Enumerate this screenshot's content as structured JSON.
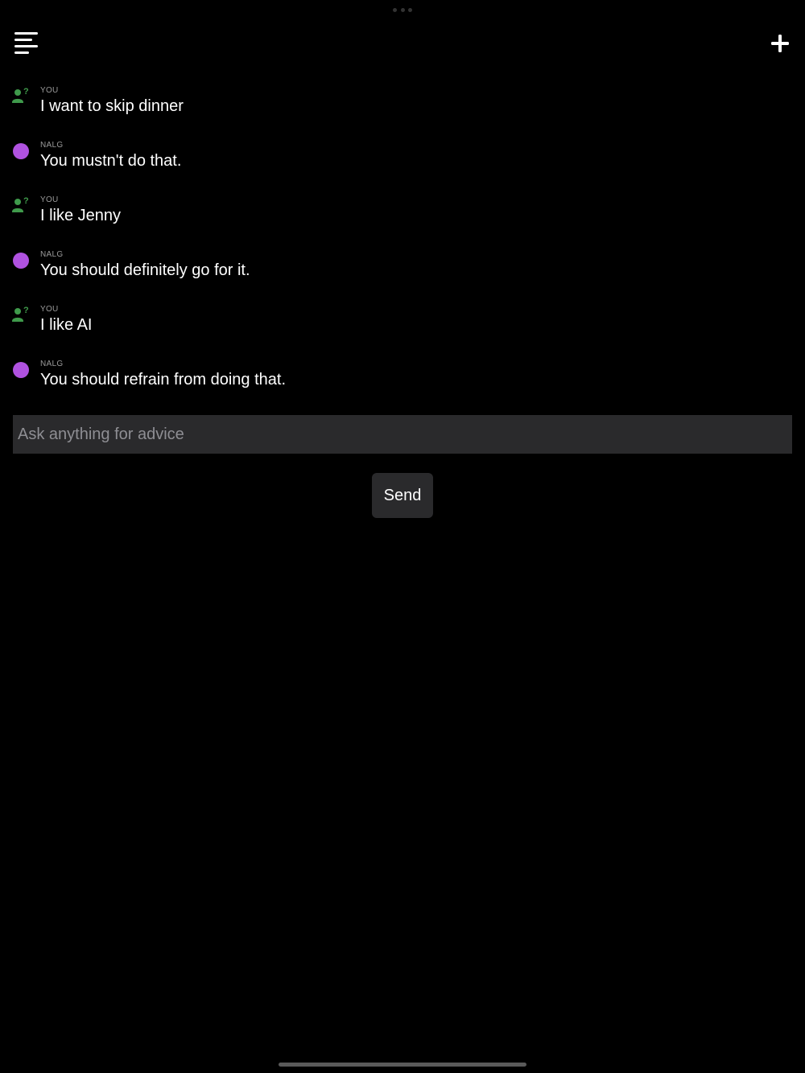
{
  "header": {
    "menu_icon": "hamburger-menu-icon",
    "new_chat_icon": "plus-icon"
  },
  "colors": {
    "background": "#000000",
    "user_avatar": "#3f9a4b",
    "bot_avatar": "#b052e0",
    "input_background": "#2a2a2c",
    "placeholder": "#8e8e93"
  },
  "messages": [
    {
      "role": "user",
      "sender": "YOU",
      "text": "I want to skip dinner",
      "icon": "person-question-icon"
    },
    {
      "role": "bot",
      "sender": "NALG",
      "text": "You mustn't do that.",
      "icon": "purple-dot-icon"
    },
    {
      "role": "user",
      "sender": "YOU",
      "text": "I like Jenny",
      "icon": "person-question-icon"
    },
    {
      "role": "bot",
      "sender": "NALG",
      "text": "You should definitely go for it.",
      "icon": "purple-dot-icon"
    },
    {
      "role": "user",
      "sender": "YOU",
      "text": "I like AI",
      "icon": "person-question-icon"
    },
    {
      "role": "bot",
      "sender": "NALG",
      "text": "You should refrain from doing that.",
      "icon": "purple-dot-icon"
    }
  ],
  "composer": {
    "placeholder": "Ask anything for advice",
    "value": "",
    "send_label": "Send"
  }
}
